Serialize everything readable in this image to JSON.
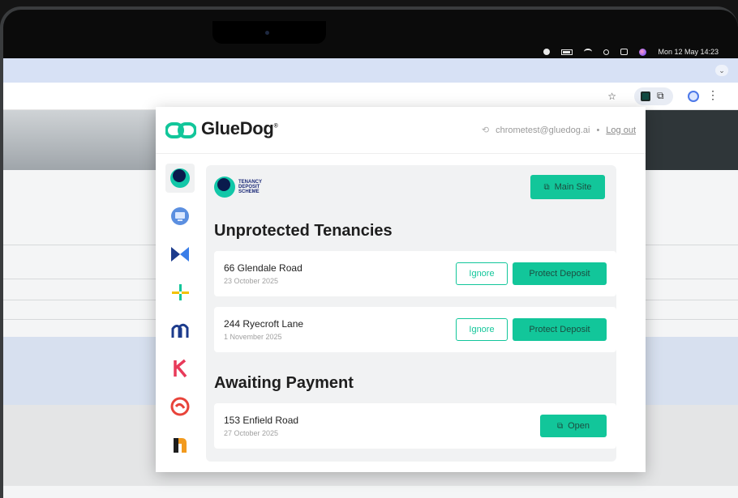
{
  "menubar": {
    "datetime": "Mon 12 May  14:23",
    "icons": [
      "user-icon",
      "battery-icon",
      "wifi-icon",
      "search-icon",
      "control-center-icon",
      "siri-icon"
    ]
  },
  "browser": {
    "tab_chevron": "⌄",
    "toolbar_icons": [
      "bookmark-star-icon",
      "extension-gluedog-icon",
      "extensions-puzzle-icon",
      "profile-icon",
      "menu-dots-icon"
    ]
  },
  "popup": {
    "brand": "GlueDog",
    "brand_mark": "®",
    "account_email": "chrometest@gluedog.ai",
    "separator": "•",
    "logout_label": "Log out",
    "provider_logo_text": [
      "TENANCY",
      "DEPOSIT",
      "SCHEME"
    ],
    "main_site_label": "Main Site",
    "sidebar_icons": [
      "tds-provider-icon",
      "provider-2-icon",
      "provider-3-icon",
      "provider-4-icon",
      "provider-5-icon",
      "provider-k-icon",
      "provider-7-icon",
      "provider-8-icon"
    ],
    "unprotected": {
      "title": "Unprotected Tenancies",
      "ignore_label": "Ignore",
      "protect_label": "Protect Deposit",
      "items": [
        {
          "address": "66 Glendale Road",
          "date": "23 October 2025"
        },
        {
          "address": "244 Ryecroft Lane",
          "date": "1 November 2025"
        }
      ]
    },
    "awaiting": {
      "title": "Awaiting Payment",
      "open_label": "Open",
      "items": [
        {
          "address": "153 Enfield Road",
          "date": "27 October 2025"
        }
      ]
    }
  },
  "colors": {
    "accent": "#12c69a",
    "accent_text": "#1b4d40",
    "brand_navy": "#0a1b4d"
  }
}
